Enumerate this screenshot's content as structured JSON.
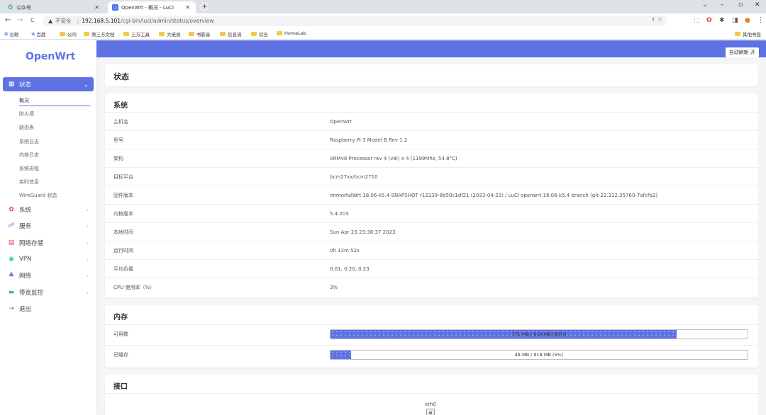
{
  "browser": {
    "tabs": [
      {
        "title": "公众号",
        "close": "✕"
      },
      {
        "title": "OpenWrt - 概况 - LuCI",
        "close": "✕"
      }
    ],
    "new_tab": "+",
    "window_controls": {
      "dropdown": "⌄",
      "minimize": "–",
      "restore": "▫",
      "close": "✕"
    },
    "nav": {
      "back": "←",
      "forward": "→",
      "reload": "C"
    },
    "address": {
      "insecure_label": "不安全",
      "host": "192.168.5.101",
      "path": "/cgi-bin/luci/admin/status/overview"
    },
    "bookmarks": [
      "谷歌",
      "百度",
      "公司",
      "第三方文档",
      "三方工具",
      "大佬说",
      "书影音",
      "信息流",
      "综合",
      "HomeLab"
    ],
    "bookmarks_other": "其他书签"
  },
  "sidebar": {
    "logo": "OpenWrt",
    "status_menu": {
      "label": "状态",
      "chevron": "⌄"
    },
    "status_items": [
      "概况",
      "防火墙",
      "路由表",
      "系统日志",
      "内核日志",
      "系统进程",
      "实时信息",
      "WireGuard 状态"
    ],
    "menus": [
      {
        "label": "系统",
        "chevron": "›"
      },
      {
        "label": "服务",
        "chevron": "›"
      },
      {
        "label": "网络存储",
        "chevron": "›"
      },
      {
        "label": "VPN",
        "chevron": "›"
      },
      {
        "label": "网络",
        "chevron": "›"
      },
      {
        "label": "带宽监控",
        "chevron": "›"
      }
    ],
    "logout": "退出"
  },
  "header": {
    "auto_refresh": "自动刷新 开"
  },
  "page_title": "状态",
  "system": {
    "title": "系统",
    "rows": [
      {
        "key": "主机名",
        "value": "OpenWrt"
      },
      {
        "key": "型号",
        "value": "Raspberry Pi 3 Model B Rev 1.2"
      },
      {
        "key": "架构",
        "value": "ARMv8 Processor rev 4 (v8l) x 4 (1199Mhz, 54.8°C)"
      },
      {
        "key": "目标平台",
        "value": "bcm27xx/bcm2710"
      },
      {
        "key": "固件版本",
        "value": "ImmortalWrt 18.06-k5.4-SNAPSHOT r12339-8b50c1df21 (2023-04-23) / LuCI openwrt-18.06-k5.4 branch (git-22.312.35760-7afcfb2)"
      },
      {
        "key": "内核版本",
        "value": "5.4.203"
      },
      {
        "key": "本地时间",
        "value": "Sun Apr 23 23:38:37 2023"
      },
      {
        "key": "运行时间",
        "value": "0h 12m 52s"
      },
      {
        "key": "平均负载",
        "value": "0.01, 0.20, 0.23"
      },
      {
        "key": "CPU 使用率（%）",
        "value": "3%"
      }
    ]
  },
  "memory": {
    "title": "内存",
    "rows": [
      {
        "key": "可用数",
        "text": "771 MB / 918 MB (83%)",
        "fraction": 0.83
      },
      {
        "key": "已缓存",
        "text": "48 MB / 918 MB (5%)",
        "fraction": 0.05
      }
    ]
  },
  "interfaces": {
    "title": "接口",
    "ports": [
      "eth0"
    ]
  }
}
